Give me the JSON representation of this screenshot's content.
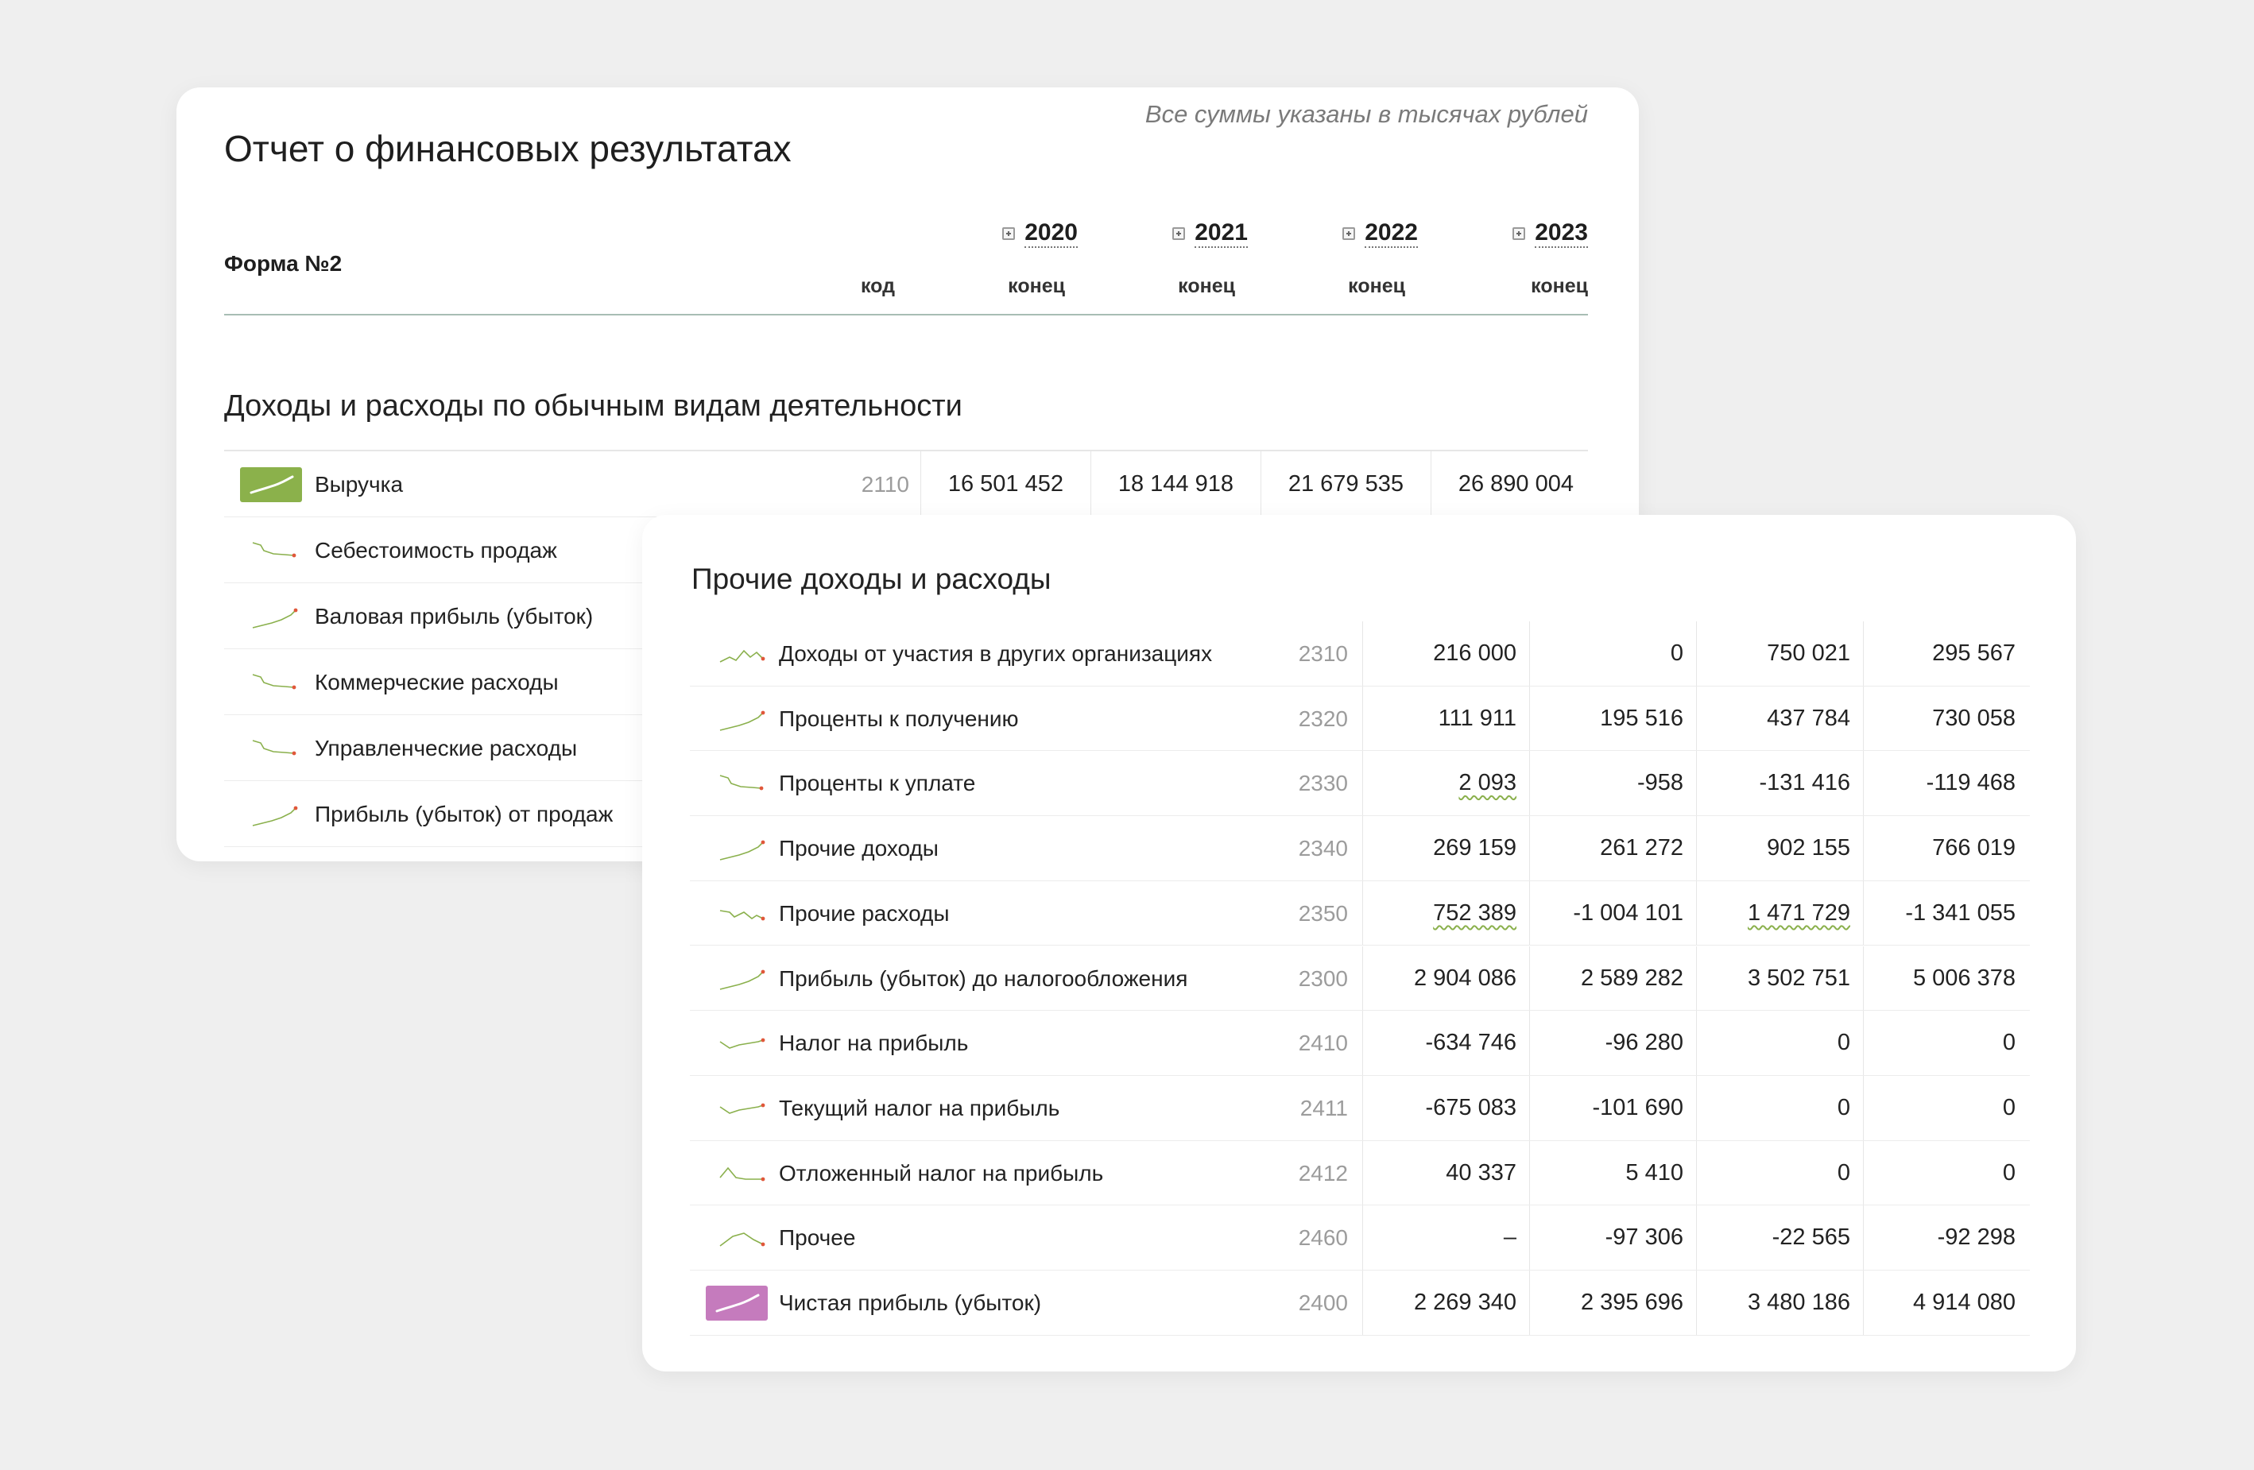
{
  "main_card": {
    "title": "Отчет о финансовых результатах",
    "note": "Все суммы указаны в тысячах рублей",
    "form_label": "Форма №2",
    "columns": {
      "code": "код",
      "years": [
        {
          "year": "2020",
          "sub": "конец"
        },
        {
          "year": "2021",
          "sub": "конец"
        },
        {
          "year": "2022",
          "sub": "конец"
        },
        {
          "year": "2023",
          "sub": "конец"
        }
      ]
    },
    "section_title": "Доходы и расходы по обычным видам деятельности",
    "rows": [
      {
        "label": "Выручка",
        "code": "2110",
        "values": [
          "16 501 452",
          "18 144 918",
          "21 679 535",
          "26 890 004"
        ],
        "spark": "up-smooth",
        "highlight": "green"
      },
      {
        "label": "Себестоимость продаж",
        "spark": "down"
      },
      {
        "label": "Валовая прибыль (убыток)",
        "spark": "up"
      },
      {
        "label": "Коммерческие расходы",
        "spark": "down"
      },
      {
        "label": "Управленческие расходы",
        "spark": "down"
      },
      {
        "label": "Прибыль (убыток) от продаж",
        "spark": "up"
      }
    ]
  },
  "other_card": {
    "section_title": "Прочие доходы и расходы",
    "rows": [
      {
        "label": "Доходы от участия в других организациях",
        "code": "2310",
        "values": [
          "216 000",
          "0",
          "750 021",
          "295 567"
        ],
        "spark": "wave",
        "squiggle": [
          false,
          false,
          false,
          false
        ]
      },
      {
        "label": "Проценты к получению",
        "code": "2320",
        "values": [
          "111 911",
          "195 516",
          "437 784",
          "730 058"
        ],
        "spark": "up",
        "squiggle": [
          false,
          false,
          false,
          false
        ]
      },
      {
        "label": "Проценты к уплате",
        "code": "2330",
        "values": [
          "2 093",
          "-958",
          "-131 416",
          "-119 468"
        ],
        "spark": "down",
        "squiggle": [
          true,
          false,
          false,
          false
        ]
      },
      {
        "label": "Прочие доходы",
        "code": "2340",
        "values": [
          "269 159",
          "261 272",
          "902 155",
          "766 019"
        ],
        "spark": "up",
        "squiggle": [
          false,
          false,
          false,
          false
        ]
      },
      {
        "label": "Прочие расходы",
        "code": "2350",
        "values": [
          "752 389",
          "-1 004 101",
          "1 471 729",
          "-1 341 055"
        ],
        "spark": "zigzag",
        "squiggle": [
          true,
          false,
          true,
          false
        ]
      },
      {
        "label": "Прибыль (убыток) до налогообложения",
        "code": "2300",
        "values": [
          "2 904 086",
          "2 589 282",
          "3 502 751",
          "5 006 378"
        ],
        "spark": "up",
        "squiggle": [
          false,
          false,
          false,
          false
        ]
      },
      {
        "label": "Налог на прибыль",
        "code": "2410",
        "values": [
          "-634 746",
          "-96 280",
          "0",
          "0"
        ],
        "spark": "check",
        "squiggle": [
          false,
          false,
          false,
          false
        ]
      },
      {
        "label": "Текущий налог на прибыль",
        "code": "2411",
        "values": [
          "-675 083",
          "-101 690",
          "0",
          "0"
        ],
        "spark": "check",
        "squiggle": [
          false,
          false,
          false,
          false
        ]
      },
      {
        "label": "Отложенный налог на прибыль",
        "code": "2412",
        "values": [
          "40 337",
          "5 410",
          "0",
          "0"
        ],
        "spark": "peak-down",
        "squiggle": [
          false,
          false,
          false,
          false
        ]
      },
      {
        "label": "Прочее",
        "code": "2460",
        "values": [
          "–",
          "-97 306",
          "-22 565",
          "-92 298"
        ],
        "spark": "hump",
        "squiggle": [
          false,
          false,
          false,
          false
        ]
      },
      {
        "label": "Чистая прибыль (убыток)",
        "code": "2400",
        "values": [
          "2 269 340",
          "2 395 696",
          "3 480 186",
          "4 914 080"
        ],
        "spark": "up-smooth",
        "highlight": "purple",
        "squiggle": [
          false,
          false,
          false,
          false
        ]
      }
    ]
  },
  "colors": {
    "background": "#efefef",
    "card": "#ffffff",
    "spark_line": "#8ab04c",
    "spark_dot": "#e0573a",
    "highlight_green": "#8bb14b",
    "highlight_purple": "#c57bbd",
    "code_text": "#9c9c9c"
  }
}
